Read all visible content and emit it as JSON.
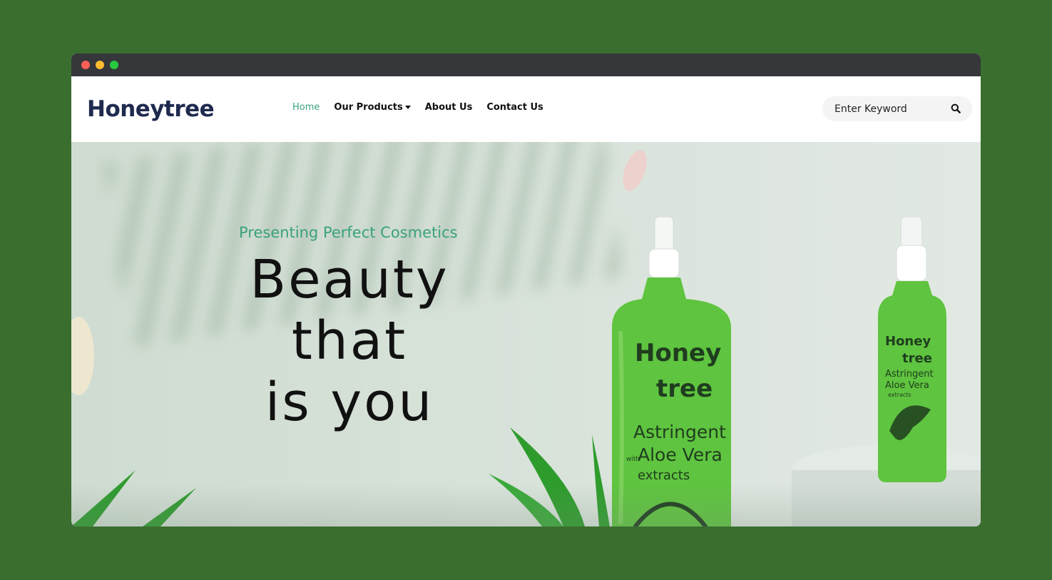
{
  "browser": {
    "controls": [
      "close",
      "minimize",
      "maximize"
    ]
  },
  "header": {
    "logo_text": "Honeytree",
    "nav": {
      "home": "Home",
      "our_products": "Our Products",
      "about_us": "About Us",
      "contact_us": "Contact Us"
    },
    "search": {
      "placeholder": "Enter Keyword",
      "icon": "search-icon"
    }
  },
  "hero": {
    "tagline": "Presenting Perfect Cosmetics",
    "headline_line1": "Beauty that",
    "headline_line2": "is you",
    "product_label": {
      "brand_line1": "Honey",
      "brand_line2": "tree",
      "product_line1": "Astringent",
      "product_line2": "Aloe Vera",
      "product_prefix": "with",
      "product_line3": "extracts"
    }
  },
  "colors": {
    "page_background": "#3a6e2f",
    "accent": "#3aa17e",
    "logo": "#1f2a4f",
    "bottle": "#5fc43f"
  }
}
